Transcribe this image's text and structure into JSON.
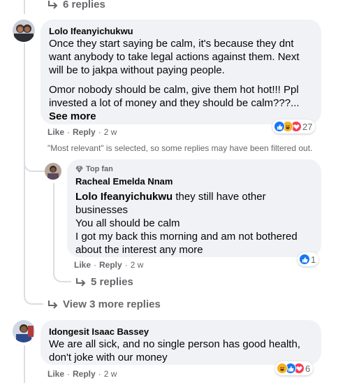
{
  "top_replies": {
    "label": "6 replies"
  },
  "comment1": {
    "author": "Lolo Ifeanyichukwu",
    "paragraph1": "Once they start saying be calm, it's because they dnt want anybody to take legal actions against them. Next will be to jakpa without paying people.",
    "paragraph2": "Omor nobody should be calm, give them hot hot!!! Ppl invested a lot of money and they should be calm???...",
    "see_more": "See more",
    "like": "Like",
    "reply": "Reply",
    "time": "2 w",
    "reaction_count": "27"
  },
  "filter_note": "\"Most relevant\" is selected, so some replies may have been filtered out.",
  "reply1": {
    "badge": "Top fan",
    "author": "Racheal Emelda Nnam",
    "mention": "Lolo Ifeanyichukwu",
    "line1_rest": " they still have other businesses",
    "line2": "You all should be calm",
    "line3": "I got my back this morning and am not bothered about the interest any more",
    "like": "Like",
    "reply": "Reply",
    "time": "2 w",
    "reaction_count": "1",
    "replies_label": "5 replies"
  },
  "view_more": {
    "label": "View 3 more replies"
  },
  "comment2": {
    "author": "Idongesit Isaac Bassey",
    "text": "We are all sick, and no single person has good health, don't joke with our money",
    "like": "Like",
    "reply": "Reply",
    "time": "2 w",
    "reaction_count": "6"
  },
  "colors": {
    "bubble": "#f0f2f5",
    "like_blue": "#1877f2",
    "love_red": "#f33e58",
    "haha_yellow": "#f7b125",
    "muted": "#65676b"
  }
}
